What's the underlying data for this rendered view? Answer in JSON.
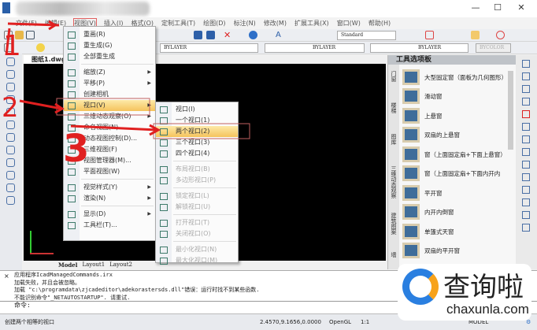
{
  "window": {
    "minimize": "—",
    "maximize": "☐",
    "close": "✕"
  },
  "menubar": [
    "文件(F)",
    "编辑(E)",
    "视图(V)",
    "插入(I)",
    "格式(O)",
    "定制工具(T)",
    "绘图(D)",
    "标注(N)",
    "修改(M)",
    "扩展工具(X)",
    "窗口(W)",
    "帮助(H)"
  ],
  "toolbar": {
    "textstyle": "Standard",
    "color": "BYLAYER",
    "linetype": "BYLAYER",
    "lineweight": "BYLAYER",
    "plotstyle": "BYCOLOR"
  },
  "doc_tab": "图纸1.dwg",
  "layout_tabs": [
    "Model",
    "Layout1",
    "Layout2"
  ],
  "view_menu": [
    {
      "label": "重画(R)"
    },
    {
      "label": "重生成(G)"
    },
    {
      "label": "全部重生成"
    },
    {
      "sep": true
    },
    {
      "label": "缩放(Z)",
      "sub": true
    },
    {
      "label": "平移(P)",
      "sub": true
    },
    {
      "label": "创建相机"
    },
    {
      "label": "视口(V)",
      "sub": true,
      "hl": true
    },
    {
      "label": "三维动态观察(O)",
      "sub": true
    },
    {
      "label": "命名视图(N)..."
    },
    {
      "label": "动态视图控制(D)..."
    },
    {
      "label": "三维视图(F)"
    },
    {
      "label": "视图管理器(M)..."
    },
    {
      "label": "平面视图(W)"
    },
    {
      "sep": true
    },
    {
      "label": "视觉样式(Y)",
      "sub": true
    },
    {
      "label": "渲染(N)",
      "sub": true
    },
    {
      "sep": true
    },
    {
      "label": "显示(D)",
      "sub": true
    },
    {
      "label": "工具栏(T)..."
    }
  ],
  "viewport_menu": [
    {
      "label": "视口(I)"
    },
    {
      "label": "一个视口(1)"
    },
    {
      "label": "两个视口(2)",
      "hl": true
    },
    {
      "label": "三个视口(3)"
    },
    {
      "label": "四个视口(4)"
    },
    {
      "sep": true
    },
    {
      "label": "布局视口(B)",
      "dis": true
    },
    {
      "label": "多边形视口(P)",
      "dis": true
    },
    {
      "sep": true
    },
    {
      "label": "锁定视口(L)",
      "dis": true
    },
    {
      "label": "解锁视口(U)",
      "dis": true
    },
    {
      "sep": true
    },
    {
      "label": "打开视口(T)",
      "dis": true
    },
    {
      "label": "关闭视口(O)",
      "dis": true
    },
    {
      "sep": true
    },
    {
      "label": "最小化视口(N)",
      "dis": true
    },
    {
      "label": "最大化视口(M)",
      "dis": true
    }
  ],
  "palette": {
    "title": "工具选项板",
    "side_tabs": [
      "门窗",
      "楼梯",
      "图库",
      "三维动态观察",
      "建筑图案",
      "墙"
    ],
    "items": [
      "大型固定窗（面板为几何图形）",
      "滑动窗",
      "上悬窗",
      "双扇的上悬窗",
      "窗（上面固定扇+下面上悬窗）",
      "窗（上面固定扇+下面内开内",
      "平开窗",
      "内开内倒窗",
      "单篷式天窗",
      "双扇的平开窗"
    ]
  },
  "command": {
    "lines": [
      "应用程序IcadManagedCommands.irx",
      "加载失败，并且会被忽略。",
      "加载 \"c:\\programdata\\zjcadeditor\\adekorastersds.dll\"错误：运行时找不到某些函数.",
      "不能识别命令\"_NETAUTOSTARTUP\". 请重试."
    ],
    "prompt": "命令:"
  },
  "status": {
    "message": "创建两个相等的视口",
    "coords": "2.4570,9.1656,0.0000",
    "renderer": "OpenGL",
    "scale": "1:1",
    "mode": "MODEL"
  },
  "annotations": [
    "1",
    "2",
    "3"
  ],
  "watermark": {
    "name": "查询啦",
    "url": "chaxunla.com"
  },
  "colors": {
    "highlight": "#f5c35c",
    "annotation": "#e02020"
  }
}
